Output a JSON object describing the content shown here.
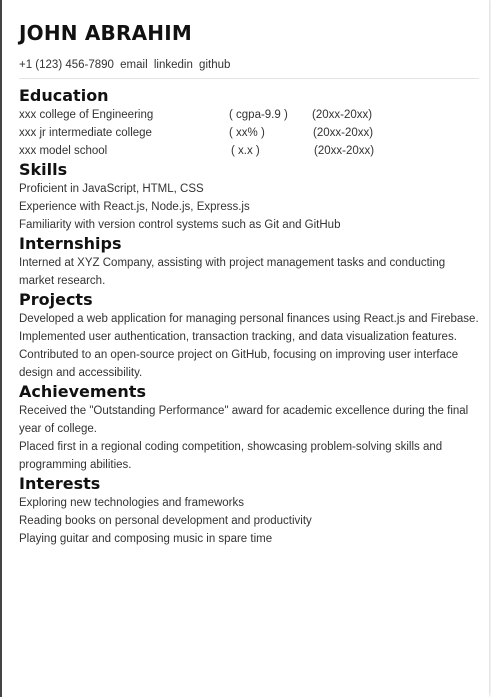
{
  "name": "JOHN ABRAHIM",
  "contact": {
    "phone": "+1 (123) 456-7890",
    "email": "email",
    "linkedin": "linkedin",
    "github": "github"
  },
  "education": {
    "title": "Education",
    "rows": [
      {
        "school": "xxx college of Engineering",
        "score": "( cgpa-9.9 )",
        "years": "(20xx-20xx)"
      },
      {
        "school": "xxx jr intermediate college",
        "score": "( xx% )",
        "years": "(20xx-20xx)"
      },
      {
        "school": "xxx model school",
        "score": "( x.x )",
        "years": "(20xx-20xx)"
      }
    ]
  },
  "skills": {
    "title": "Skills",
    "items": [
      "Proficient in JavaScript, HTML, CSS",
      "Experience with React.js, Node.js, Express.js",
      "Familiarity with version control systems such as Git and GitHub"
    ]
  },
  "internships": {
    "title": "Internships",
    "items": [
      "Interned at XYZ Company, assisting with project management tasks and conducting market research."
    ]
  },
  "projects": {
    "title": "Projects",
    "items": [
      "Developed a web application for managing personal finances using React.js and Firebase.",
      "Implemented user authentication, transaction tracking, and data visualization features.",
      "Contributed to an open-source project on GitHub, focusing on improving user interface design and accessibility."
    ]
  },
  "achievements": {
    "title": "Achievements",
    "items": [
      "Received the \"Outstanding Performance\" award for academic excellence during the final year of college.",
      "Placed first in a regional coding competition, showcasing problem-solving skills and programming abilities."
    ]
  },
  "interests": {
    "title": "Interests",
    "items": [
      "Exploring new technologies and frameworks",
      "Reading books on personal development and productivity",
      "Playing guitar and composing music in spare time"
    ]
  }
}
